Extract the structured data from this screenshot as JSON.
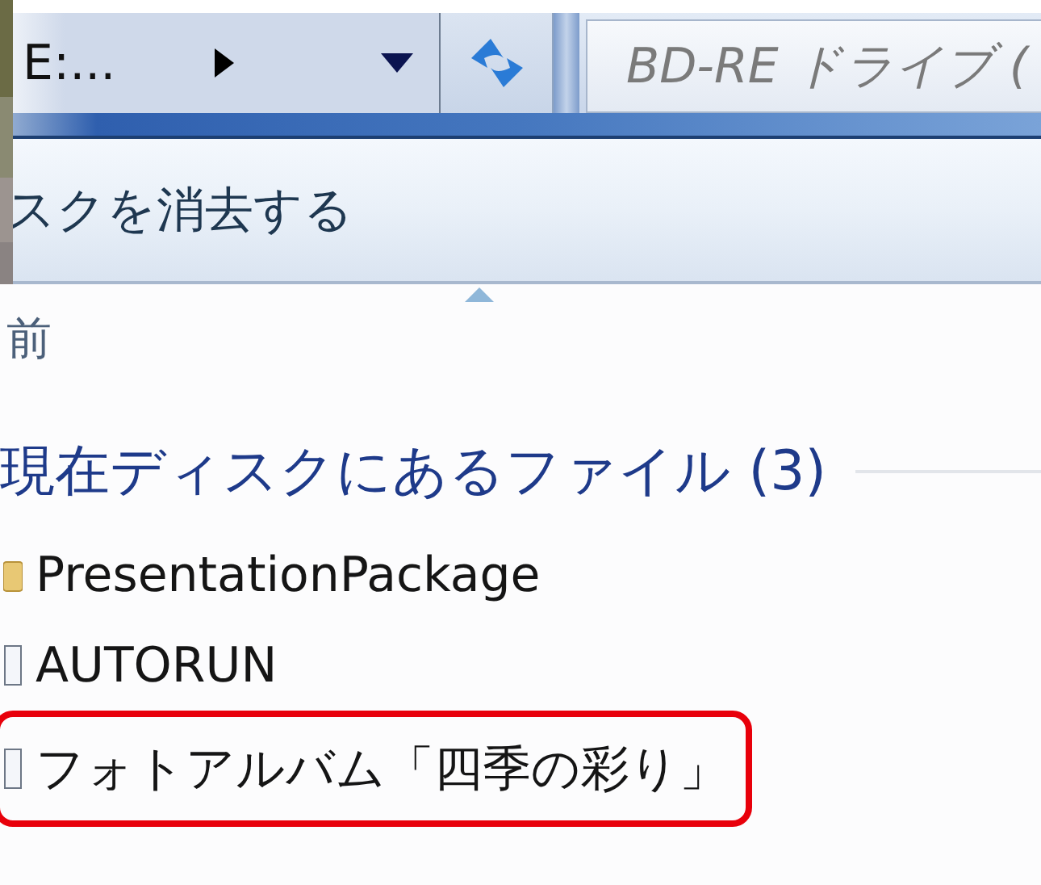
{
  "address_bar": {
    "crumb": "E:..."
  },
  "search": {
    "placeholder": "BD-RE ドライブ ("
  },
  "command_bar": {
    "commands": [
      "スクを消去する"
    ]
  },
  "columns": [
    {
      "label": "前",
      "sorted": true
    }
  ],
  "group": {
    "title": "現在ディスクにあるファイル (3)"
  },
  "files": [
    {
      "name": "PresentationPackage",
      "kind": "folder",
      "highlighted": false
    },
    {
      "name": "AUTORUN",
      "kind": "file",
      "highlighted": false
    },
    {
      "name": "フォトアルバム「四季の彩り」",
      "kind": "file",
      "highlighted": true
    }
  ]
}
